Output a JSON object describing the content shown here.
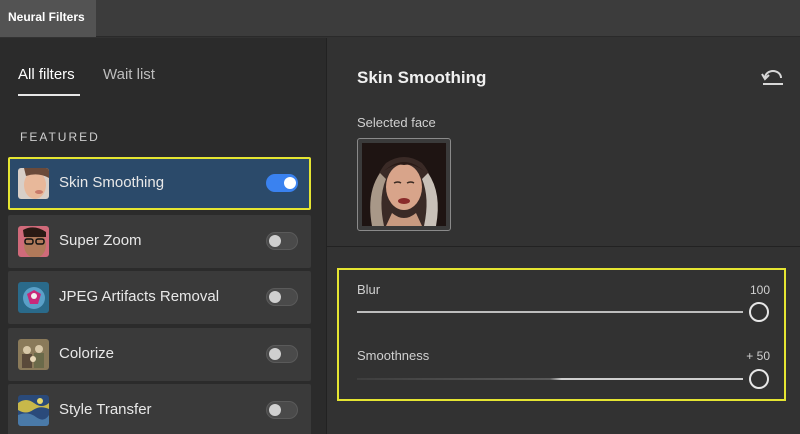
{
  "window": {
    "tab_title": "Neural Filters"
  },
  "left_panel": {
    "tabs": [
      {
        "label": "All filters",
        "active": true
      },
      {
        "label": "Wait list",
        "active": false
      }
    ],
    "section_label": "FEATURED",
    "filters": [
      {
        "label": "Skin Smoothing",
        "enabled": true,
        "selected": true,
        "thumb_icon": "face-thumbnail"
      },
      {
        "label": "Super Zoom",
        "enabled": false,
        "selected": false,
        "thumb_icon": "glasses-face-thumbnail"
      },
      {
        "label": "JPEG Artifacts Removal",
        "enabled": false,
        "selected": false,
        "thumb_icon": "bird-thumbnail"
      },
      {
        "label": "Colorize",
        "enabled": false,
        "selected": false,
        "thumb_icon": "group-photo-thumbnail"
      },
      {
        "label": "Style Transfer",
        "enabled": false,
        "selected": false,
        "thumb_icon": "painting-thumbnail"
      }
    ]
  },
  "right_panel": {
    "title": "Skin Smoothing",
    "reset_icon": "reset-icon",
    "selected_face_label": "Selected face",
    "sliders": [
      {
        "label": "Blur",
        "value_text": "100",
        "value": 100,
        "min": 0,
        "max": 100
      },
      {
        "label": "Smoothness",
        "value_text": "+ 50",
        "value": 50,
        "min": -50,
        "max": 50
      }
    ]
  },
  "colors": {
    "accent": "#3a82f0",
    "highlight": "#e5e532",
    "selected_row": "#2b4a6a"
  }
}
